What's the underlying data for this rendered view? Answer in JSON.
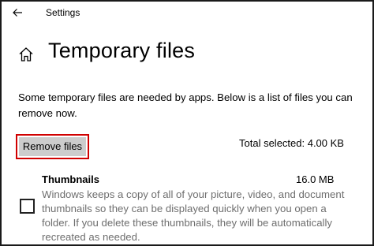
{
  "window": {
    "app_title": "Settings"
  },
  "page": {
    "title": "Temporary files",
    "description": "Some temporary files are needed by apps. Below is a list of files you can remove now."
  },
  "actions": {
    "remove_label": "Remove files",
    "accent_color": "#d00000"
  },
  "summary": {
    "total_selected": "Total selected: 4.00 KB"
  },
  "items": [
    {
      "name": "Thumbnails",
      "size": "16.0 MB",
      "description": "Windows keeps a copy of all of your picture, video, and document thumbnails so they can be displayed quickly when you open a folder. If you delete these thumbnails, they will be automatically recreated as needed.",
      "checked": false
    }
  ],
  "icons": {
    "back": "back-arrow-icon",
    "home": "home-icon"
  }
}
